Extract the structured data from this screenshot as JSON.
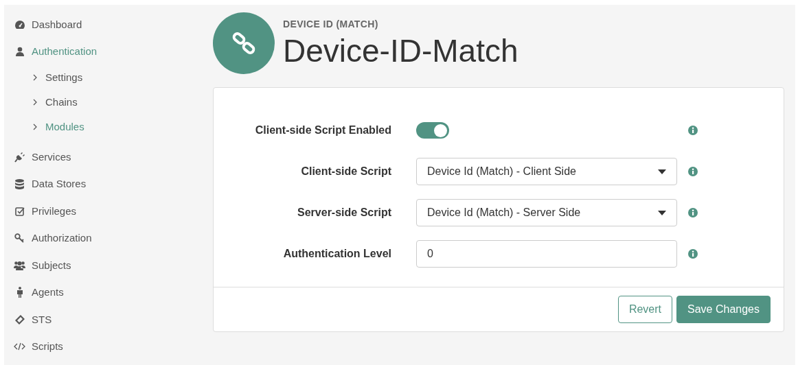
{
  "sidebar": {
    "items": [
      {
        "label": "Dashboard",
        "selected": false
      },
      {
        "label": "Authentication",
        "selected": true,
        "children": [
          {
            "label": "Settings",
            "selected": false
          },
          {
            "label": "Chains",
            "selected": false
          },
          {
            "label": "Modules",
            "selected": true
          }
        ]
      },
      {
        "label": "Services",
        "selected": false
      },
      {
        "label": "Data Stores",
        "selected": false
      },
      {
        "label": "Privileges",
        "selected": false
      },
      {
        "label": "Authorization",
        "selected": false
      },
      {
        "label": "Subjects",
        "selected": false
      },
      {
        "label": "Agents",
        "selected": false
      },
      {
        "label": "STS",
        "selected": false
      },
      {
        "label": "Scripts",
        "selected": false
      }
    ]
  },
  "header": {
    "type_label": "DEVICE ID (MATCH)",
    "title": "Device-ID-Match"
  },
  "form": {
    "fields": [
      {
        "kind": "toggle",
        "label": "Client-side Script Enabled",
        "on": true
      },
      {
        "kind": "select",
        "label": "Client-side Script",
        "value": "Device Id (Match) - Client Side"
      },
      {
        "kind": "select",
        "label": "Server-side Script",
        "value": "Device Id (Match) - Server Side"
      },
      {
        "kind": "text",
        "label": "Authentication Level",
        "value": "0"
      }
    ],
    "buttons": [
      {
        "label": "Revert",
        "kind": "secondary"
      },
      {
        "label": "Save Changes",
        "kind": "primary"
      }
    ]
  }
}
